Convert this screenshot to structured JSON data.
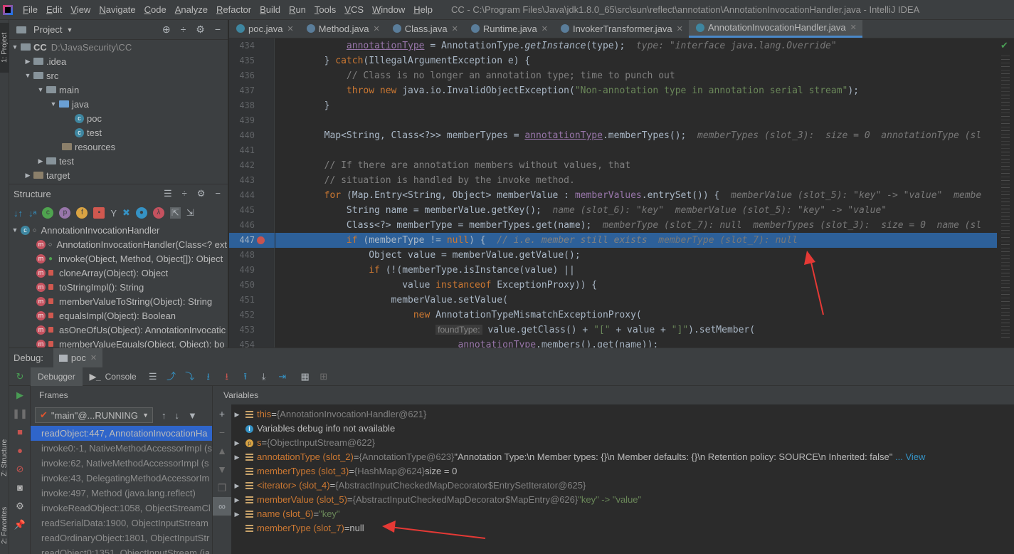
{
  "menubar": {
    "items": [
      "File",
      "Edit",
      "View",
      "Navigate",
      "Code",
      "Analyze",
      "Refactor",
      "Build",
      "Run",
      "Tools",
      "VCS",
      "Window",
      "Help"
    ],
    "title": "CC - C:\\Program Files\\Java\\jdk1.8.0_65\\src\\sun\\reflect\\annotation\\AnnotationInvocationHandler.java - IntelliJ IDEA"
  },
  "left_strip": {
    "project": "1: Project",
    "structure": "Z: Structure",
    "favorites": "2: Favorites"
  },
  "project": {
    "title": "Project",
    "tree": [
      {
        "label": "CC",
        "extra": "D:\\JavaSecurity\\CC"
      },
      {
        "label": ".idea"
      },
      {
        "label": "src"
      },
      {
        "label": "main"
      },
      {
        "label": "java"
      },
      {
        "label": "poc"
      },
      {
        "label": "test"
      },
      {
        "label": "resources"
      },
      {
        "label": "test"
      },
      {
        "label": "target"
      }
    ]
  },
  "structure": {
    "title": "Structure",
    "root": "AnnotationInvocationHandler",
    "members": [
      "AnnotationInvocationHandler(Class<? ext",
      "invoke(Object, Method, Object[]): Object",
      "cloneArray(Object): Object",
      "toStringImpl(): String",
      "memberValueToString(Object): String",
      "equalsImpl(Object): Boolean",
      "asOneOfUs(Object): AnnotationInvocatic",
      "memberValueEquals(Object, Object): bo"
    ]
  },
  "tabs": [
    "poc.java",
    "Method.java",
    "Class.java",
    "Runtime.java",
    "InvokerTransformer.java",
    "AnnotationInvocationHandler.java"
  ],
  "line_numbers": [
    "434",
    "435",
    "436",
    "437",
    "438",
    "439",
    "440",
    "441",
    "442",
    "443",
    "444",
    "445",
    "446",
    "447",
    "448",
    "449",
    "450",
    "451",
    "452",
    "453",
    "454"
  ],
  "code": {
    "l434_a": "annotationType",
    "l434_b": " = AnnotationType.",
    "l434_c": "getInstance",
    "l434_d": "(type);",
    "l434_hint": "type: \"interface java.lang.Override\"",
    "l435_a": "} ",
    "l435_b": "catch",
    "l435_c": "(IllegalArgumentException e) {",
    "l436": "// Class is no longer an annotation type; time to punch out",
    "l437_a": "throw new ",
    "l437_b": "java.io.InvalidObjectException(",
    "l437_c": "\"Non-annotation type in annotation serial stream\"",
    "l437_d": ");",
    "l438": "}",
    "l440_a": "Map<String, Class<?>> memberTypes = ",
    "l440_b": "annotationType",
    "l440_c": ".memberTypes();",
    "l440_hint": "memberTypes (slot_3):  size = 0  annotationType (sl",
    "l442": "// If there are annotation members without values, that",
    "l443": "// situation is handled by the invoke method.",
    "l444_a": "for ",
    "l444_b": "(Map.Entry<String, Object> memberValue : ",
    "l444_c": "memberValues",
    "l444_d": ".entrySet()) {",
    "l444_hint": "memberValue (slot_5): \"key\" -> \"value\"  membe",
    "l445_a": "String name = memberValue.getKey();",
    "l445_hint": "name (slot_6): \"key\"  memberValue (slot_5): \"key\" -> \"value\"",
    "l446_a": "Class<?> memberType = memberTypes.get(name);",
    "l446_hint": "memberType (slot_7): null  memberTypes (slot_3):  size = 0  name (sl",
    "l447_a": "if ",
    "l447_b": "(memberType != ",
    "l447_c": "null",
    "l447_d": ") { ",
    "l447_e": "// i.e. member still exists",
    "l447_hint": "memberType (slot_7): null",
    "l448": "Object value = memberValue.getValue();",
    "l449_a": "if ",
    "l449_b": "(!(memberType.isInstance(value) ||",
    "l450_a": "value ",
    "l450_b": "instanceof ",
    "l450_c": "ExceptionProxy)) {",
    "l451": "memberValue.setValue(",
    "l452_a": "new ",
    "l452_b": "AnnotationTypeMismatchExceptionProxy(",
    "l453_hint": "foundType:",
    "l453_a": " value.getClass() + ",
    "l453_b": "\"[\"",
    "l453_c": " + value + ",
    "l453_d": "\"]\"",
    "l453_e": ").setMember(",
    "l454_a": "annotationType",
    "l454_b": ".members().get(name));"
  },
  "debug": {
    "label": "Debug:",
    "session": "poc",
    "tabs": [
      "Debugger",
      "Console"
    ],
    "frames_title": "Frames",
    "variables_title": "Variables",
    "thread": "\"main\"@...RUNNING",
    "frames": [
      "readObject:447, AnnotationInvocationHa",
      "invoke0:-1, NativeMethodAccessorImpl (s",
      "invoke:62, NativeMethodAccessorImpl (s",
      "invoke:43, DelegatingMethodAccessorIm",
      "invoke:497, Method (java.lang.reflect)",
      "invokeReadObject:1058, ObjectStreamCl",
      "readSerialData:1900, ObjectInputStream",
      "readOrdinaryObject:1801, ObjectInputStr",
      "readObject0:1351, ObjectInputStream (ja"
    ],
    "variables": [
      {
        "name": "this",
        "eq": " = ",
        "val": "{AnnotationInvocationHandler@621}",
        "str": ""
      },
      {
        "name": "",
        "eq": "",
        "val": "Variables debug info not available",
        "str": ""
      },
      {
        "name": "s",
        "eq": " = ",
        "val": "{ObjectInputStream@622}",
        "str": ""
      },
      {
        "name": "annotationType (slot_2)",
        "eq": " = ",
        "val": "{AnnotationType@623} ",
        "str": "\"Annotation Type:\\n   Member types: {}\\n   Member defaults: {}\\n   Retention policy: SOURCE\\n   Inherited: false\"",
        "link": "... View"
      },
      {
        "name": "memberTypes (slot_3)",
        "eq": " = ",
        "val": "{HashMap@624} ",
        "str": "size = 0"
      },
      {
        "name": "<iterator> (slot_4)",
        "eq": " = ",
        "val": "{AbstractInputCheckedMapDecorator$EntrySetIterator@625}",
        "str": ""
      },
      {
        "name": "memberValue (slot_5)",
        "eq": " = ",
        "val": "{AbstractInputCheckedMapDecorator$MapEntry@626} ",
        "str": "\"key\" -> \"value\""
      },
      {
        "name": "name (slot_6)",
        "eq": " = ",
        "val": "",
        "str": "\"key\""
      },
      {
        "name": "memberType (slot_7)",
        "eq": " = ",
        "val": "",
        "str": "null"
      }
    ]
  },
  "colors": {
    "accent": "#4a88c7",
    "highlight": "#2d6099",
    "arrow": "#e53935"
  }
}
